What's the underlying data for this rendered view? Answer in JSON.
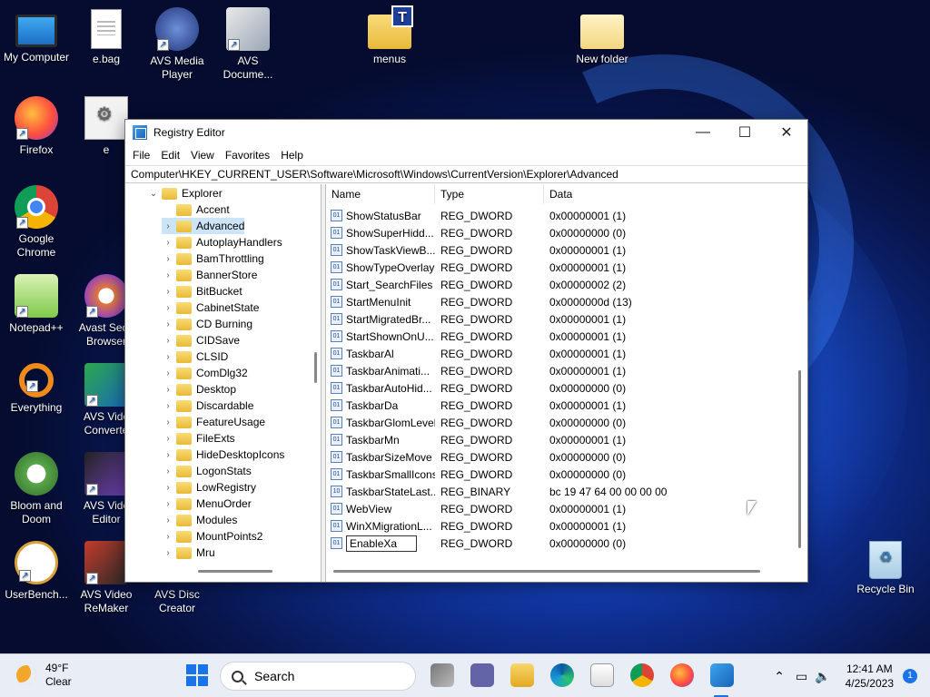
{
  "desktop": {
    "icons": [
      {
        "label": "My Computer",
        "icon": "computer-icon"
      },
      {
        "label": "e.bag",
        "icon": "document-icon"
      },
      {
        "label": "AVS Media Player",
        "icon": "media-player-icon"
      },
      {
        "label": "AVS Docume...",
        "icon": "document-converter-icon"
      },
      {
        "label": "menus",
        "icon": "folder-icon"
      },
      {
        "label": "New folder",
        "icon": "folder-icon"
      },
      {
        "label": "Firefox",
        "icon": "firefox-icon"
      },
      {
        "label": "e",
        "icon": "settings-file-icon"
      },
      {
        "label": "Google Chrome",
        "icon": "chrome-icon"
      },
      {
        "label": "Notepad++",
        "icon": "notepadpp-icon"
      },
      {
        "label": "Avast Secu Browser",
        "icon": "avast-browser-icon"
      },
      {
        "label": "Everything",
        "icon": "everything-search-icon"
      },
      {
        "label": "AVS Vide Converte",
        "icon": "video-converter-icon"
      },
      {
        "label": "Bloom and Doom",
        "icon": "game-icon"
      },
      {
        "label": "AVS Vide Editor",
        "icon": "video-editor-icon"
      },
      {
        "label": "UserBench...",
        "icon": "userbenchmark-icon"
      },
      {
        "label": "AVS Video ReMaker",
        "icon": "video-remaker-icon"
      },
      {
        "label": "AVS Disc Creator",
        "icon": "disc-creator-icon"
      },
      {
        "label": "Recycle Bin",
        "icon": "recycle-bin-icon"
      }
    ]
  },
  "regedit": {
    "title": "Registry Editor",
    "window_buttons": {
      "minimize": "—",
      "maximize": "☐",
      "close": "✕"
    },
    "menu": [
      "File",
      "Edit",
      "View",
      "Favorites",
      "Help"
    ],
    "address": "Computer\\HKEY_CURRENT_USER\\Software\\Microsoft\\Windows\\CurrentVersion\\Explorer\\Advanced",
    "tree": {
      "parent": "Explorer",
      "children": [
        "Accent",
        "Advanced",
        "AutoplayHandlers",
        "BamThrottling",
        "BannerStore",
        "BitBucket",
        "CabinetState",
        "CD Burning",
        "CIDSave",
        "CLSID",
        "ComDlg32",
        "Desktop",
        "Discardable",
        "FeatureUsage",
        "FileExts",
        "HideDesktopIcons",
        "LogonStats",
        "LowRegistry",
        "MenuOrder",
        "Modules",
        "MountPoints2",
        "Mru"
      ],
      "selected": "Advanced"
    },
    "columns": [
      "Name",
      "Type",
      "Data"
    ],
    "values": [
      {
        "name": "ShowStatusBar",
        "type": "REG_DWORD",
        "data": "0x00000001 (1)"
      },
      {
        "name": "ShowSuperHidd...",
        "type": "REG_DWORD",
        "data": "0x00000000 (0)"
      },
      {
        "name": "ShowTaskViewB...",
        "type": "REG_DWORD",
        "data": "0x00000001 (1)"
      },
      {
        "name": "ShowTypeOverlay",
        "type": "REG_DWORD",
        "data": "0x00000001 (1)"
      },
      {
        "name": "Start_SearchFiles",
        "type": "REG_DWORD",
        "data": "0x00000002 (2)"
      },
      {
        "name": "StartMenuInit",
        "type": "REG_DWORD",
        "data": "0x0000000d (13)"
      },
      {
        "name": "StartMigratedBr...",
        "type": "REG_DWORD",
        "data": "0x00000001 (1)"
      },
      {
        "name": "StartShownOnU...",
        "type": "REG_DWORD",
        "data": "0x00000001 (1)"
      },
      {
        "name": "TaskbarAl",
        "type": "REG_DWORD",
        "data": "0x00000001 (1)"
      },
      {
        "name": "TaskbarAnimati...",
        "type": "REG_DWORD",
        "data": "0x00000001 (1)"
      },
      {
        "name": "TaskbarAutoHid...",
        "type": "REG_DWORD",
        "data": "0x00000000 (0)"
      },
      {
        "name": "TaskbarDa",
        "type": "REG_DWORD",
        "data": "0x00000001 (1)"
      },
      {
        "name": "TaskbarGlomLevel",
        "type": "REG_DWORD",
        "data": "0x00000000 (0)"
      },
      {
        "name": "TaskbarMn",
        "type": "REG_DWORD",
        "data": "0x00000001 (1)"
      },
      {
        "name": "TaskbarSizeMove",
        "type": "REG_DWORD",
        "data": "0x00000000 (0)"
      },
      {
        "name": "TaskbarSmallIcons",
        "type": "REG_DWORD",
        "data": "0x00000000 (0)"
      },
      {
        "name": "TaskbarStateLast...",
        "type": "REG_BINARY",
        "data": "bc 19 47 64 00 00 00 00"
      },
      {
        "name": "WebView",
        "type": "REG_DWORD",
        "data": "0x00000001 (1)"
      },
      {
        "name": "WinXMigrationL...",
        "type": "REG_DWORD",
        "data": "0x00000001 (1)"
      }
    ],
    "editing_value": {
      "name": "EnableXa",
      "type": "REG_DWORD",
      "data": "0x00000000 (0)"
    }
  },
  "taskbar": {
    "weather": {
      "temp": "49°F",
      "condition": "Clear"
    },
    "search_label": "Search",
    "pinned": [
      "start-icon",
      "search-icon",
      "task-view-icon",
      "teams-chat-icon",
      "file-explorer-icon",
      "edge-icon",
      "store-icon",
      "chrome-icon",
      "firefox-icon",
      "regedit-icon"
    ],
    "tray": {
      "time": "12:41 AM",
      "date": "4/25/2023",
      "notifications": "1"
    }
  },
  "colors": {
    "selection": "#cce4f7",
    "accent": "#1a73e8"
  }
}
